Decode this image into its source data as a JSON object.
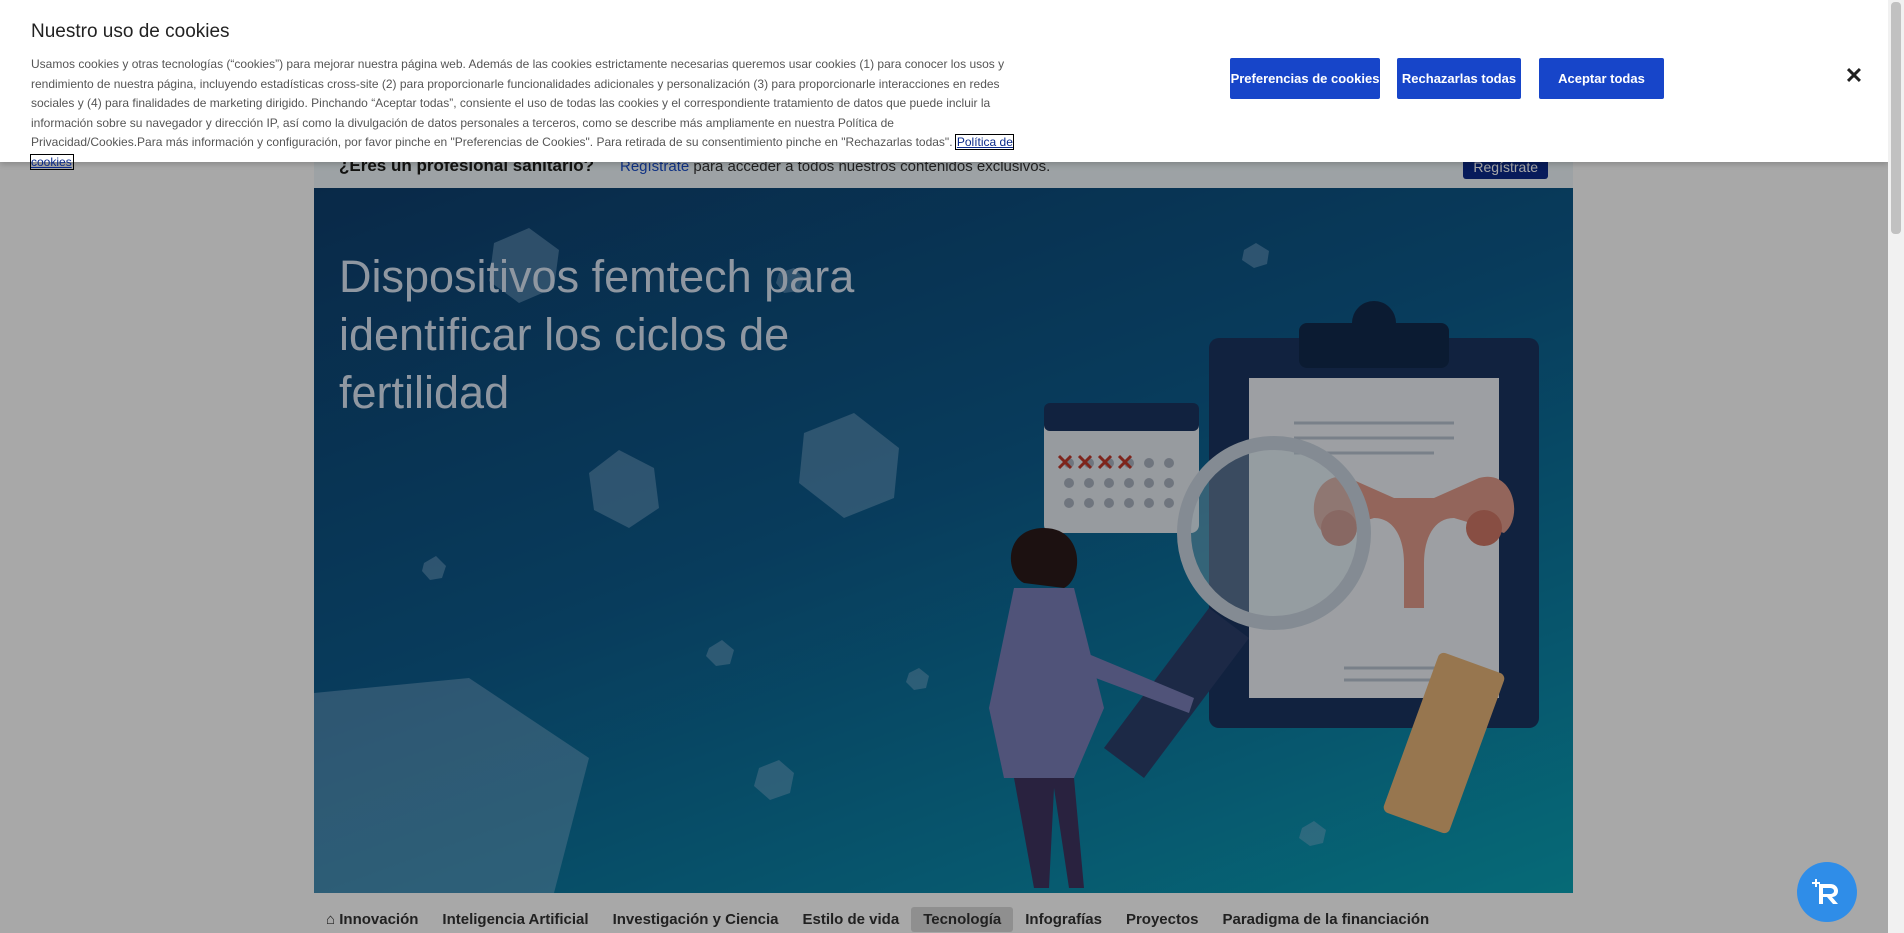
{
  "cookie": {
    "title": "Nuestro uso de cookies",
    "body": "Usamos cookies y otras tecnologías (“cookies”) para mejorar nuestra página web. Además de las cookies estrictamente necesarias queremos usar cookies (1) para conocer los usos y rendimiento de nuestra página, incluyendo estadísticas cross-site (2) para proporcionarle funcionalidades adicionales y personalización (3) para proporcionarle interacciones en redes sociales y (4) para finalidades de marketing dirigido. Pinchando “Aceptar todas”, consiente el uso de todas las cookies y el correspondiente tratamiento de datos que puede incluir la información sobre su navegador y dirección IP, así como la divulgación de datos personales a terceros, como se describe más ampliamente en nuestra Política de Privacidad/Cookies.Para más información y configuración, por favor pinche en \"Preferencias de Cookies\". Para retirada de su consentimiento pinche en \"Rechazarlas todas\".",
    "policy_link": "Política de cookies",
    "preferences_button": "Preferencias de cookies",
    "reject_button": "Rechazarlas todas",
    "accept_button": "Aceptar todas",
    "close_glyph": "✕"
  },
  "pro_banner": {
    "question": "¿Eres un profesional sanitario?",
    "link": "Regístrate",
    "text": " para acceder a todos nuestros contenidos exclusivos.",
    "button": "Regístrate"
  },
  "hero": {
    "title": "Dispositivos femtech para identificar los ciclos de fertilidad"
  },
  "nav": {
    "items": [
      "Innovación",
      "Inteligencia Artificial",
      "Investigación y Ciencia",
      "Estilo de vida",
      "Tecnología",
      "Infografías",
      "Proyectos",
      "Paradigma de la financiación"
    ],
    "active": "Tecnología"
  },
  "colors": {
    "accent": "#1745c9",
    "fab": "#2f8de8"
  }
}
